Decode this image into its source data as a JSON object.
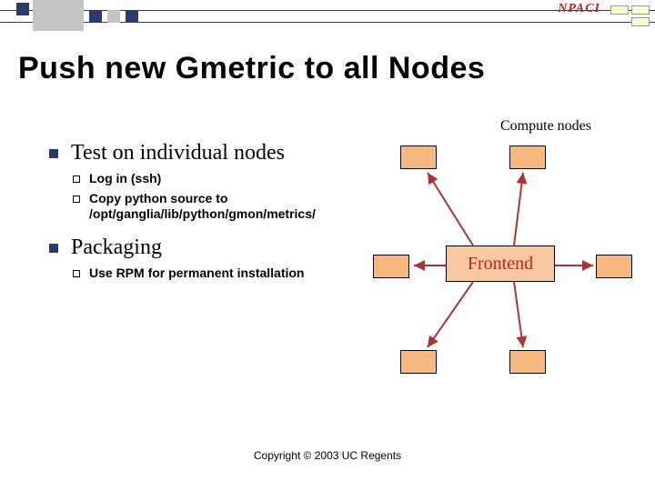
{
  "slide": {
    "title": "Push new Gmetric to all Nodes",
    "copyright": "Copyright © 2003 UC Regents",
    "logo_text": "NPACI"
  },
  "bullets": {
    "b1": {
      "text": "Test on individual nodes",
      "sub1": "Log in (ssh)",
      "sub2": "Copy python source to /opt/ganglia/lib/python/gmon/metrics/"
    },
    "b2": {
      "text": "Packaging",
      "sub1": "Use RPM for permanent installation"
    }
  },
  "diagram": {
    "compute_label": "Compute nodes",
    "frontend_label": "Frontend"
  }
}
